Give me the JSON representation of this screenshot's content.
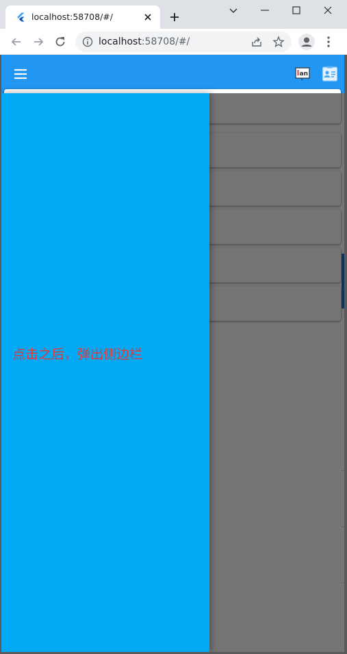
{
  "browser": {
    "tab_title": "localhost:58708/#/",
    "url_host": "localhost",
    "url_rest": ":58708/#/",
    "icons": {
      "favicon": "flutter-icon",
      "tab_close": "close-icon",
      "new_tab": "plus-icon",
      "minimize": "minimize-icon",
      "maximize": "maximize-icon",
      "close": "window-close-icon",
      "dropdown": "chevron-down-icon",
      "back": "back-arrow-icon",
      "forward": "forward-arrow-icon",
      "reload": "reload-icon",
      "info": "info-icon",
      "share": "share-icon",
      "bookmark": "star-icon",
      "profile": "profile-icon",
      "menu": "kebab-menu-icon"
    }
  },
  "app": {
    "colors": {
      "appbar": "#2196f3",
      "drawer": "#03a9f4",
      "drawer_text": "#e53935",
      "scrim": "rgba(0,0,0,0.54)"
    },
    "appbar": {
      "menu_icon": "hamburger-menu-icon",
      "actions": [
        "language-icon",
        "contact-card-icon"
      ]
    },
    "drawer": {
      "text": "点击之后，弹出侧边栏"
    }
  }
}
